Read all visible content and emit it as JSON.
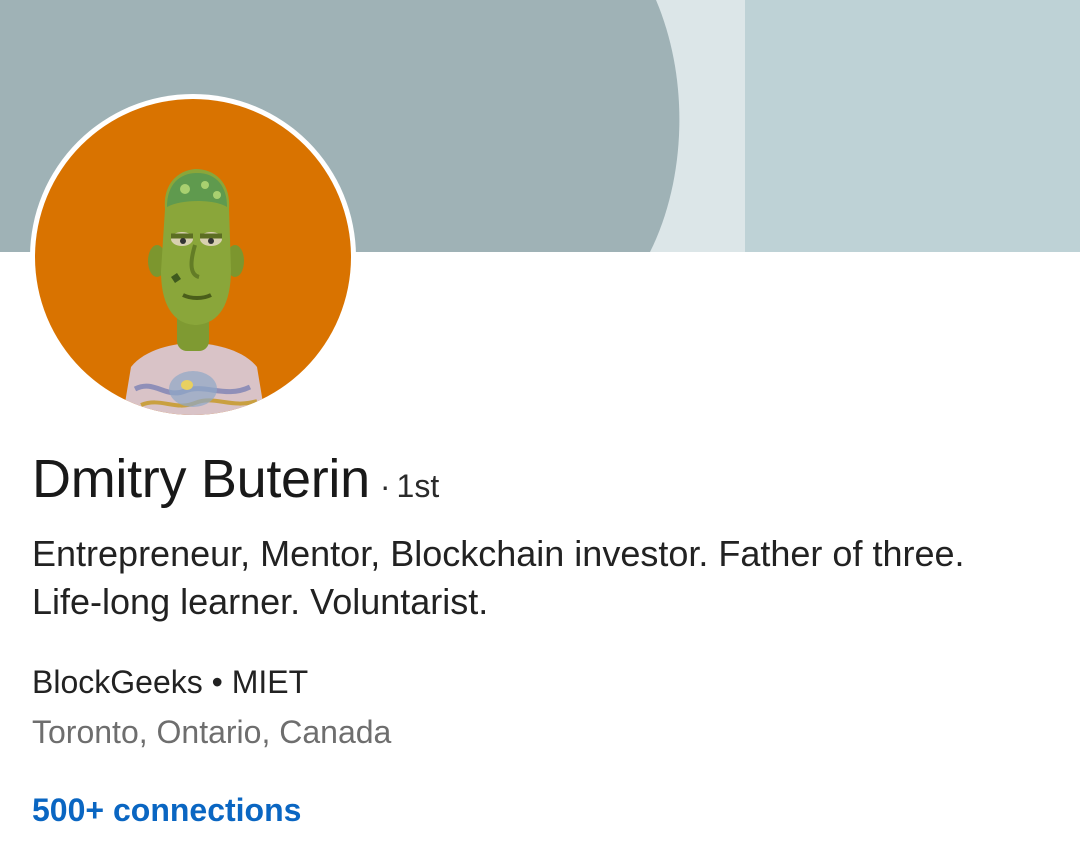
{
  "profile": {
    "name": "Dmitry Buterin",
    "degree_separator": "·",
    "degree": "1st",
    "headline": "Entrepreneur, Mentor, Blockchain investor. Father of three. Life-long learner. Voluntarist.",
    "company": "BlockGeeks • MIET",
    "location": "Toronto, Ontario, Canada",
    "connections": "500+ connections"
  },
  "colors": {
    "cover_left": "#9fb2b6",
    "cover_mid": "#dce6e8",
    "cover_right": "#bed2d6",
    "avatar_background": "#d97300",
    "link_blue": "#0a66c2"
  },
  "icons": {
    "avatar": "cartoon-character-avatar"
  }
}
